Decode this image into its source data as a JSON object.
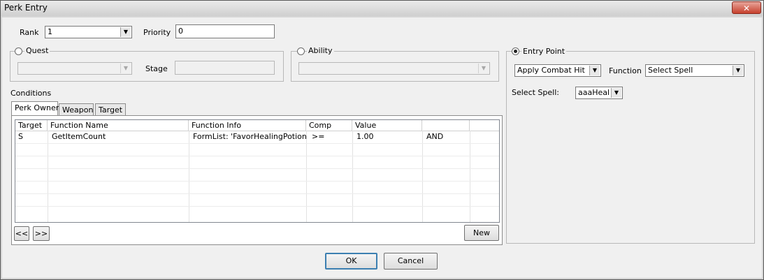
{
  "window": {
    "title": "Perk Entry",
    "close_glyph": "✕"
  },
  "rank": {
    "label": "Rank",
    "value": "1"
  },
  "priority": {
    "label": "Priority",
    "value": "0"
  },
  "quest": {
    "label": "Quest",
    "selected": false,
    "value": "",
    "stage_label": "Stage",
    "stage_value": ""
  },
  "ability": {
    "label": "Ability",
    "selected": false,
    "value": ""
  },
  "entry_point": {
    "label": "Entry Point",
    "selected": true,
    "value": "Apply Combat Hit Spe",
    "function_label": "Function",
    "function_value": "Select Spell",
    "select_spell_label": "Select Spell:",
    "select_spell_value": "aaaHealA"
  },
  "conditions": {
    "label": "Conditions",
    "tabs": [
      {
        "label": "Perk Owner",
        "active": true
      },
      {
        "label": "Weapon",
        "active": false
      },
      {
        "label": "Target",
        "active": false
      }
    ],
    "columns": [
      "Target",
      "Function Name",
      "Function Info",
      "Comp",
      "Value",
      ""
    ],
    "rows": [
      {
        "target": "S",
        "function_name": "GetItemCount",
        "function_info": "FormList: 'FavorHealingPotions'",
        "comp": ">=",
        "value": "1.00",
        "op": "AND"
      }
    ],
    "prev_label": "<<",
    "next_label": ">>",
    "new_label": "New"
  },
  "buttons": {
    "ok": "OK",
    "cancel": "Cancel"
  },
  "icons": {
    "dropdown": "chevron-down-icon",
    "close": "close-icon"
  },
  "colors": {
    "titlebar": "#dcdcdc",
    "client": "#f0f0f0",
    "close": "#c7402d",
    "default_button_border": "#3c7fb1"
  }
}
